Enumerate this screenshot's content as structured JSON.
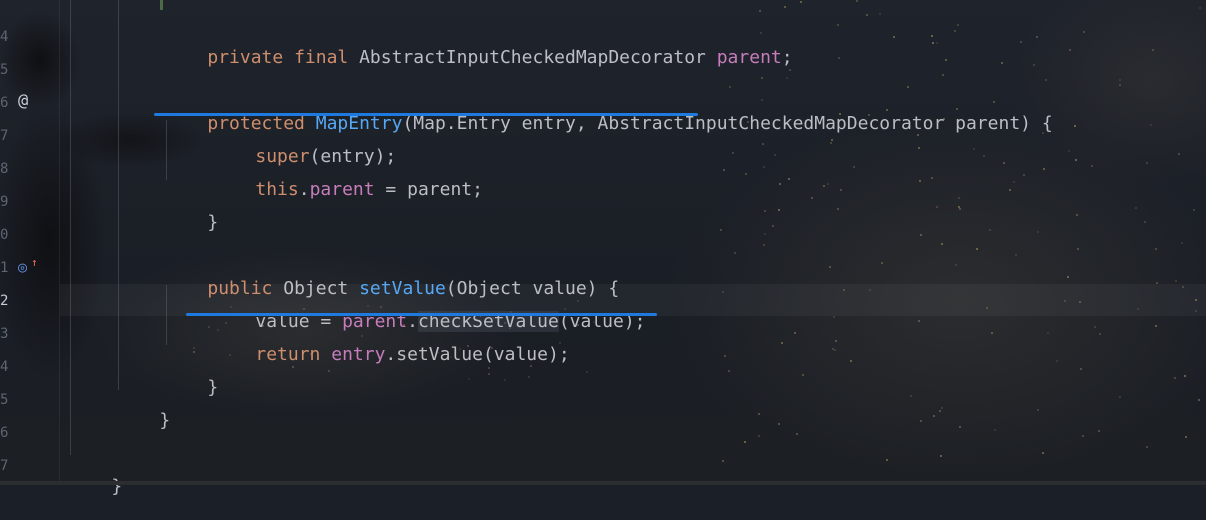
{
  "editor": {
    "gutter": {
      "line_numbers": [
        "4",
        "5",
        "6",
        "7",
        "8",
        "9",
        "0",
        "1",
        "2",
        "3",
        "4",
        "5",
        "6",
        "7"
      ],
      "active_line": "2",
      "icons": {
        "line6": "@",
        "line1_a": "◎",
        "line1_b": "↑"
      }
    },
    "lines": {
      "l4": {
        "t1": "private",
        "t2": " ",
        "t3": "final",
        "t4": " AbstractInputCheckedMapDecorator ",
        "t5": "parent",
        "t6": ";"
      },
      "l6": {
        "t1": "protected",
        "t2": " ",
        "t3": "MapEntry",
        "t4": "(Map.Entry entry, AbstractInputCheckedMapDecorator parent) {"
      },
      "l7": {
        "t1": "super",
        "t2": "(entry);"
      },
      "l8": {
        "t1": "this",
        "t2": ".",
        "t3": "parent",
        "t4": " = parent;"
      },
      "l9": {
        "t1": "}"
      },
      "l11": {
        "t1": "public",
        "t2": " Object ",
        "t3": "setValue",
        "t4": "(Object value) {"
      },
      "l12": {
        "t1": "value = ",
        "t2": "parent",
        "t3": ".",
        "t4": "checkSetValue",
        "t5": "(value);"
      },
      "l13": {
        "t1": "return",
        "t2": " ",
        "t3": "entry",
        "t4": ".setValue(value);"
      },
      "l14": {
        "t1": "}"
      },
      "l15": {
        "t1": "}"
      },
      "l17": {
        "t1": "}"
      }
    }
  },
  "colors": {
    "keyword": "#cf8e6d",
    "function": "#56a8f5",
    "field": "#c77dbb",
    "plain": "#bcbec4",
    "underline": "#1f7ae0"
  }
}
